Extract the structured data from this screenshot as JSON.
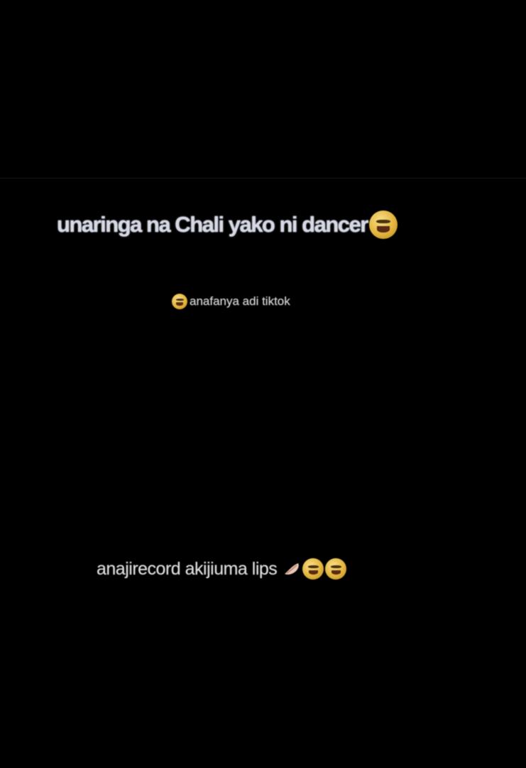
{
  "captions": {
    "line1": "unaringa na Chali yako ni dancer",
    "line2": "anafanya adi tiktok",
    "line3": "anajirecord akijiuma lips"
  },
  "icons": {
    "laughing": "laughing-face-icon",
    "lips": "lips-icon"
  },
  "colors": {
    "background": "#000000",
    "text": "#dcdcdc"
  }
}
